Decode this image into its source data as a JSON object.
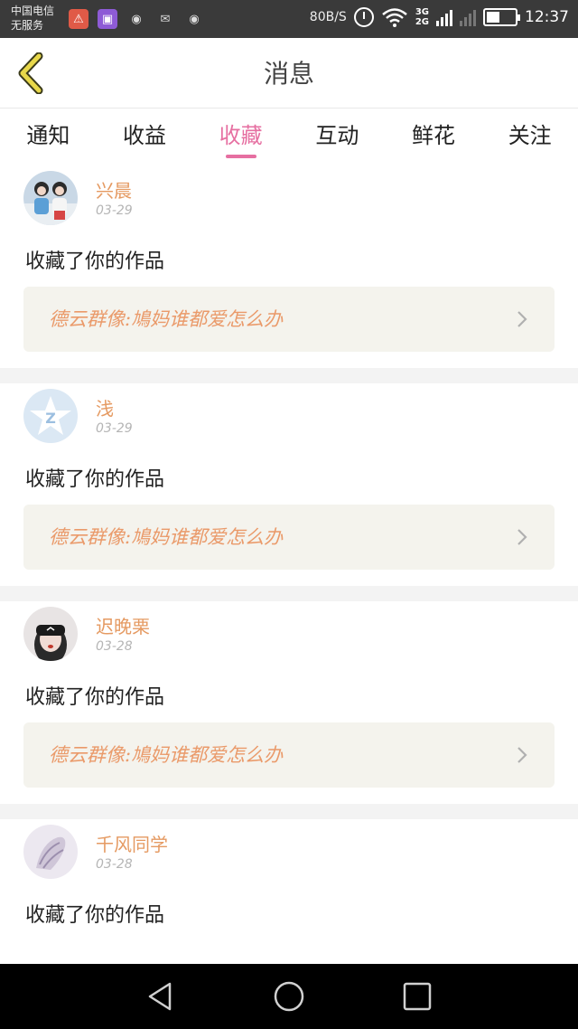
{
  "status_bar": {
    "carrier_line1": "中国电信",
    "carrier_line2": "无服务",
    "net_speed": "80B/S",
    "net_types": "3G\n2G",
    "time": "12:37"
  },
  "header": {
    "title": "消息",
    "back_icon": "chevron-left-icon"
  },
  "tabs": [
    {
      "label": "通知",
      "active": false
    },
    {
      "label": "收益",
      "active": false
    },
    {
      "label": "收藏",
      "active": true
    },
    {
      "label": "互动",
      "active": false
    },
    {
      "label": "鲜花",
      "active": false
    },
    {
      "label": "关注",
      "active": false
    }
  ],
  "feed": [
    {
      "username": "兴晨",
      "date": "03-29",
      "action": "收藏了你的作品",
      "work_title": "德云群像:鳩妈谁都爱怎么办",
      "avatar": "photo-avatar"
    },
    {
      "username": "浅",
      "date": "03-29",
      "action": "收藏了你的作品",
      "work_title": "德云群像:鳩妈谁都爱怎么办",
      "avatar": "default-avatar"
    },
    {
      "username": "迟晚栗",
      "date": "03-28",
      "action": "收藏了你的作品",
      "work_title": "德云群像:鳩妈谁都爱怎么办",
      "avatar": "photo-avatar"
    },
    {
      "username": "千风同学",
      "date": "03-28",
      "action": "收藏了你的作品",
      "work_title": "",
      "avatar": "photo-avatar"
    }
  ],
  "colors": {
    "accent_pink": "#e66fa1",
    "username_orange": "#e59a62",
    "work_title_orange": "#ea9a6a",
    "work_box_bg": "#f4f3ed"
  }
}
